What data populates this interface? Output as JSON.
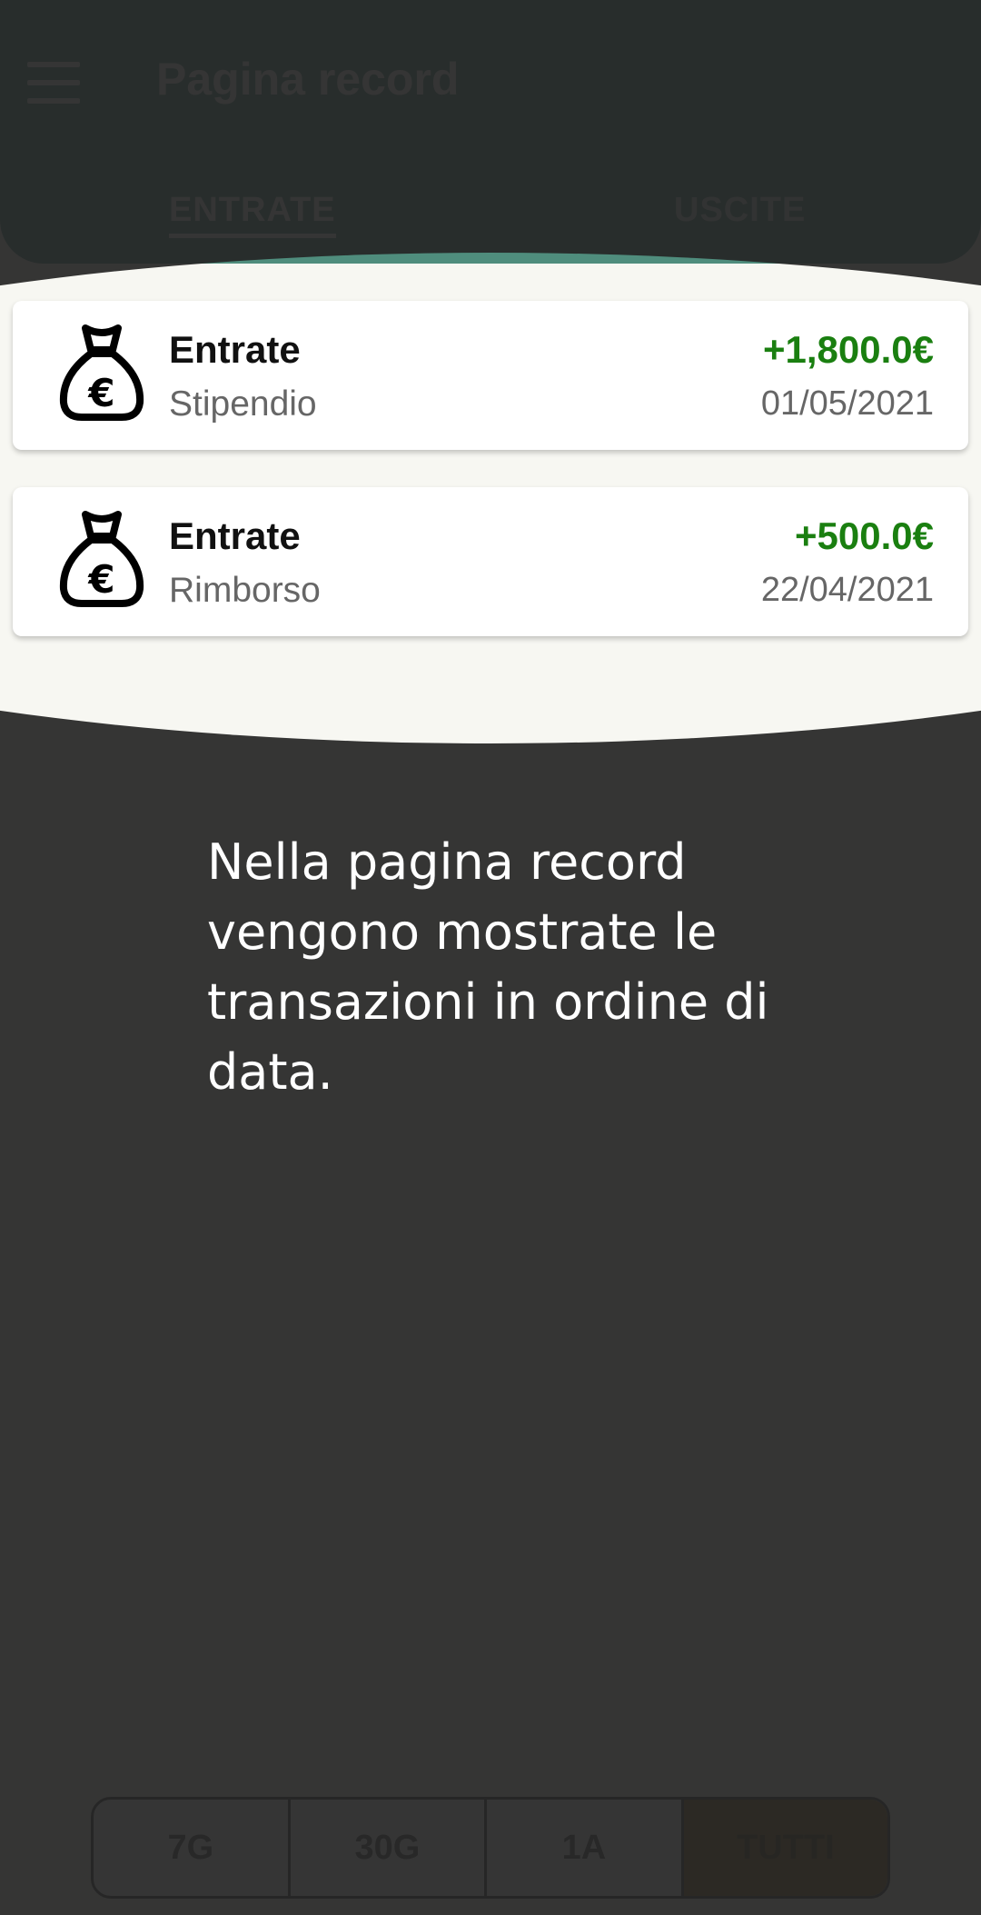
{
  "app_bar": {
    "title": "Pagina record",
    "menu_icon": "hamburger-menu-icon",
    "tabs": [
      {
        "label": "ENTRATE",
        "selected": true
      },
      {
        "label": "USCITE",
        "selected": false
      }
    ]
  },
  "transactions": [
    {
      "icon": "euro-money-bag-icon",
      "category": "Entrate",
      "note": "Stipendio",
      "amount": "+1,800.0€",
      "date": "01/05/2021"
    },
    {
      "icon": "euro-money-bag-icon",
      "category": "Entrate",
      "note": "Rimborso",
      "amount": "+500.0€",
      "date": "22/04/2021"
    }
  ],
  "tutorial": {
    "text": "Nella pagina record vengono mostrate le transazioni in ordine di data."
  },
  "filters": [
    {
      "label": "7G",
      "selected": false
    },
    {
      "label": "30G",
      "selected": false
    },
    {
      "label": "1A",
      "selected": false
    },
    {
      "label": "TUTTI",
      "selected": true
    }
  ],
  "colors": {
    "primary": "#4f8d7d",
    "income_amount": "#1a7f10",
    "overlay": "#383838",
    "highlight_background": "#f7f7f2",
    "filter_selected": "#7b5e14"
  }
}
